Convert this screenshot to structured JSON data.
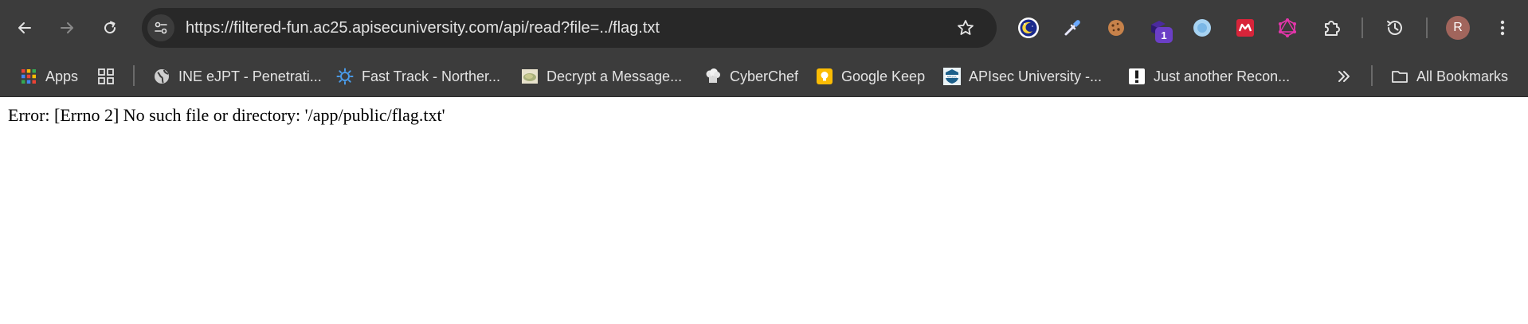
{
  "toolbar": {
    "url": "https://filtered-fun.ac25.apisecuniversity.com/api/read?file=../flag.txt",
    "profile_initial": "R",
    "extension_badge": "1"
  },
  "bookmarks": [
    {
      "label": "Apps",
      "icon": "apps-grid-icon"
    },
    {
      "label": "INE eJPT - Penetrati...",
      "icon": "globe-icon"
    },
    {
      "label": "Fast Track - Norther...",
      "icon": "sun-gear-icon"
    },
    {
      "label": "Decrypt a Message...",
      "icon": "image-thumbnail-icon"
    },
    {
      "label": "CyberChef",
      "icon": "chef-hat-icon"
    },
    {
      "label": "Google Keep",
      "icon": "keep-bulb-icon"
    },
    {
      "label": "APIsec University -...",
      "icon": "apisec-logo-icon"
    },
    {
      "label": "Just another Recon...",
      "icon": "exclamation-icon"
    },
    {
      "label": "All Bookmarks",
      "icon": "folder-icon"
    }
  ],
  "page": {
    "error": "Error: [Errno 2] No such file or directory: '/app/public/flag.txt'"
  },
  "colors": {
    "toolbar_bg": "#3c3c3c",
    "omnibox_bg": "#282828",
    "text_light": "#e3e3e3",
    "page_bg": "#ffffff"
  }
}
